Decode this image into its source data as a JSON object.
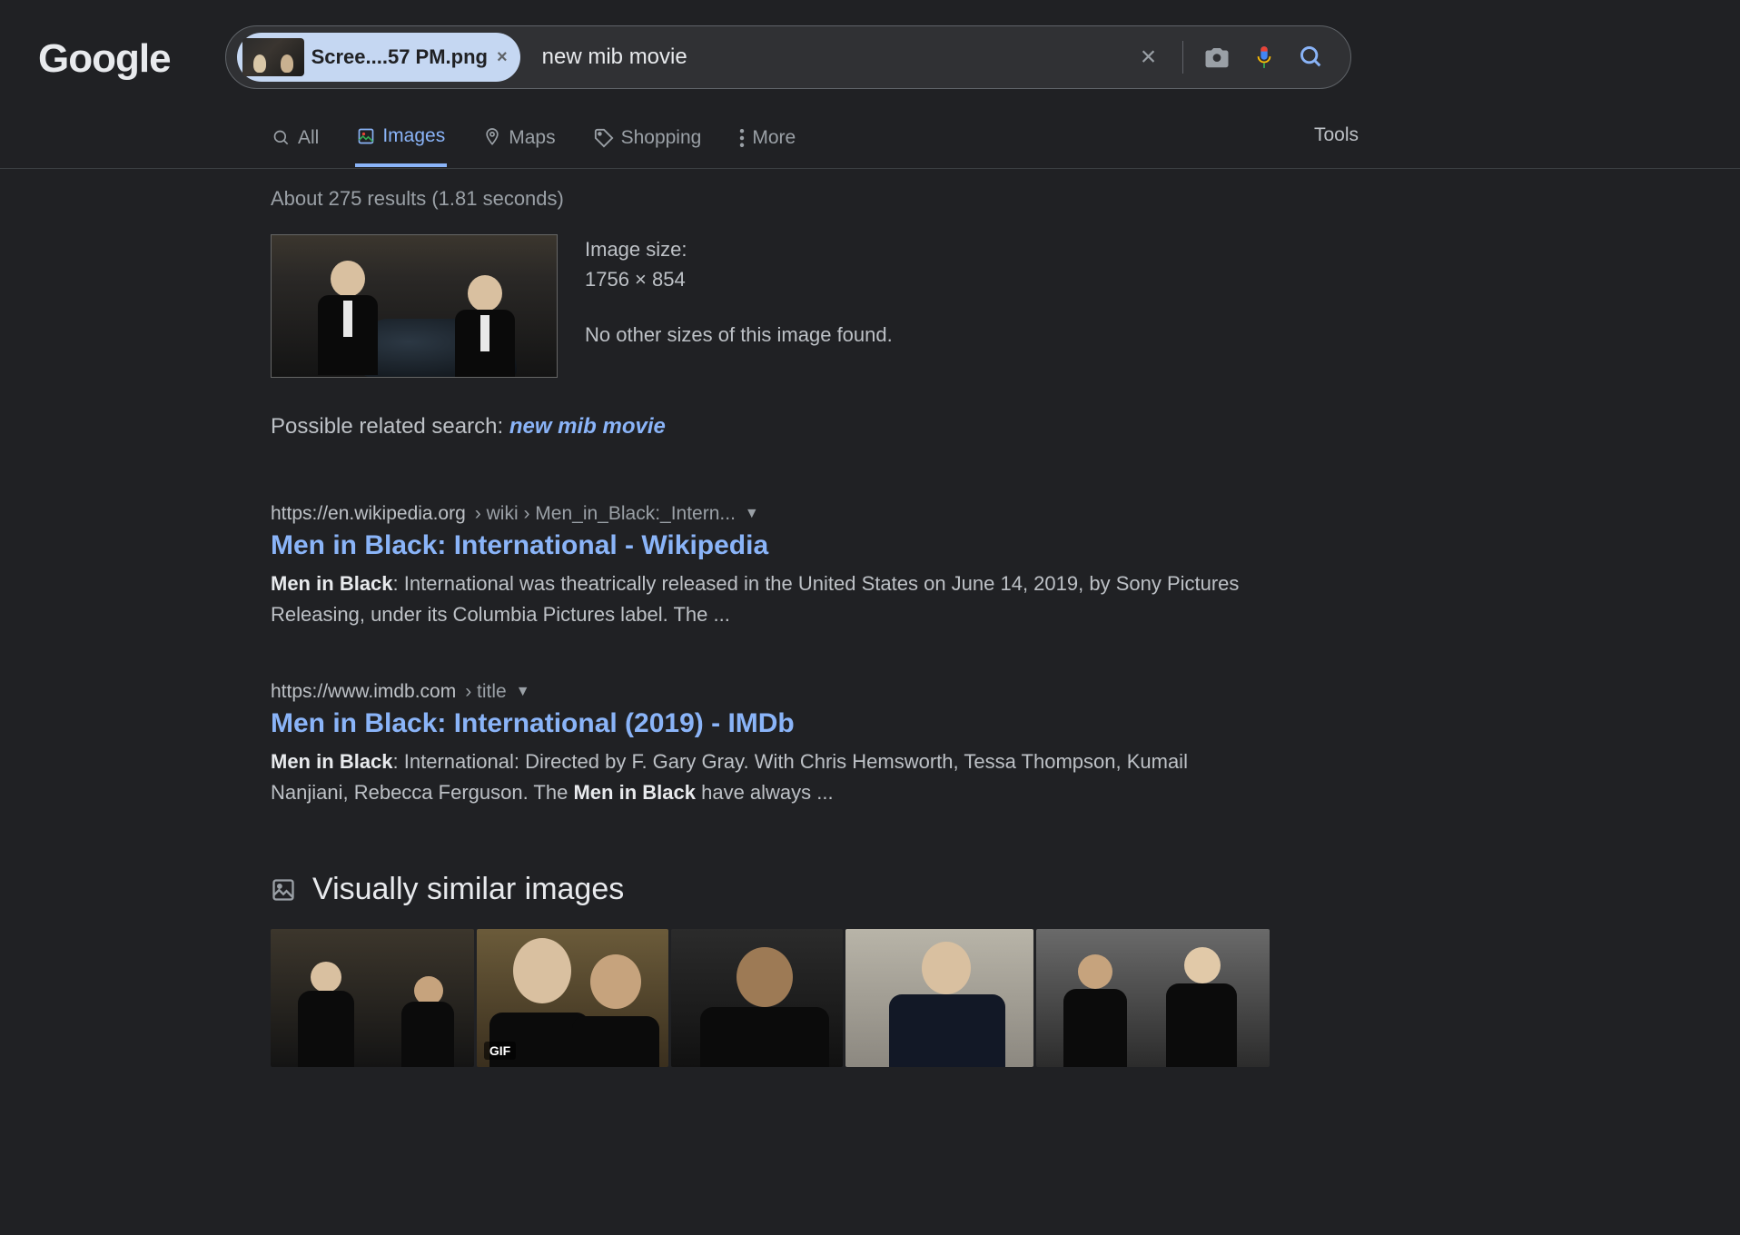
{
  "logo": "Google",
  "chip": {
    "filename": "Scree....57 PM.png"
  },
  "search": {
    "query": "new mib movie"
  },
  "tabs": {
    "all": "All",
    "images": "Images",
    "maps": "Maps",
    "shopping": "Shopping",
    "more": "More",
    "tools": "Tools"
  },
  "stats": "About 275 results (1.81 seconds)",
  "image_info": {
    "size_label": "Image size:",
    "size_value": "1756 × 854",
    "no_other": "No other sizes of this image found."
  },
  "related": {
    "label": "Possible related search: ",
    "link": "new mib movie"
  },
  "results": [
    {
      "domain": "https://en.wikipedia.org",
      "path": " › wiki › Men_in_Black:_Intern...",
      "title": "Men in Black: International - Wikipedia",
      "bold1": "Men",
      "bold2": "in",
      "bold3": "Black",
      "snip_rest": ": International was theatrically released in the United States on June 14, 2019, by Sony Pictures Releasing, under its Columbia Pictures label. The ..."
    },
    {
      "domain": "https://www.imdb.com",
      "path": " › title",
      "title": "Men in Black: International (2019) - IMDb",
      "bold1": "Men",
      "bold2": "in",
      "bold3": "Black",
      "snip_rest": ": International: Directed by F. Gary Gray. With Chris Hemsworth, Tessa Thompson, Kumail Nanjiani, Rebecca Ferguson. The ",
      "bold4": "Men",
      "bold5": "in",
      "bold6": "Black",
      "snip_tail": " have always ..."
    }
  ],
  "vs_title": "Visually similar images",
  "gif_badge": "GIF"
}
